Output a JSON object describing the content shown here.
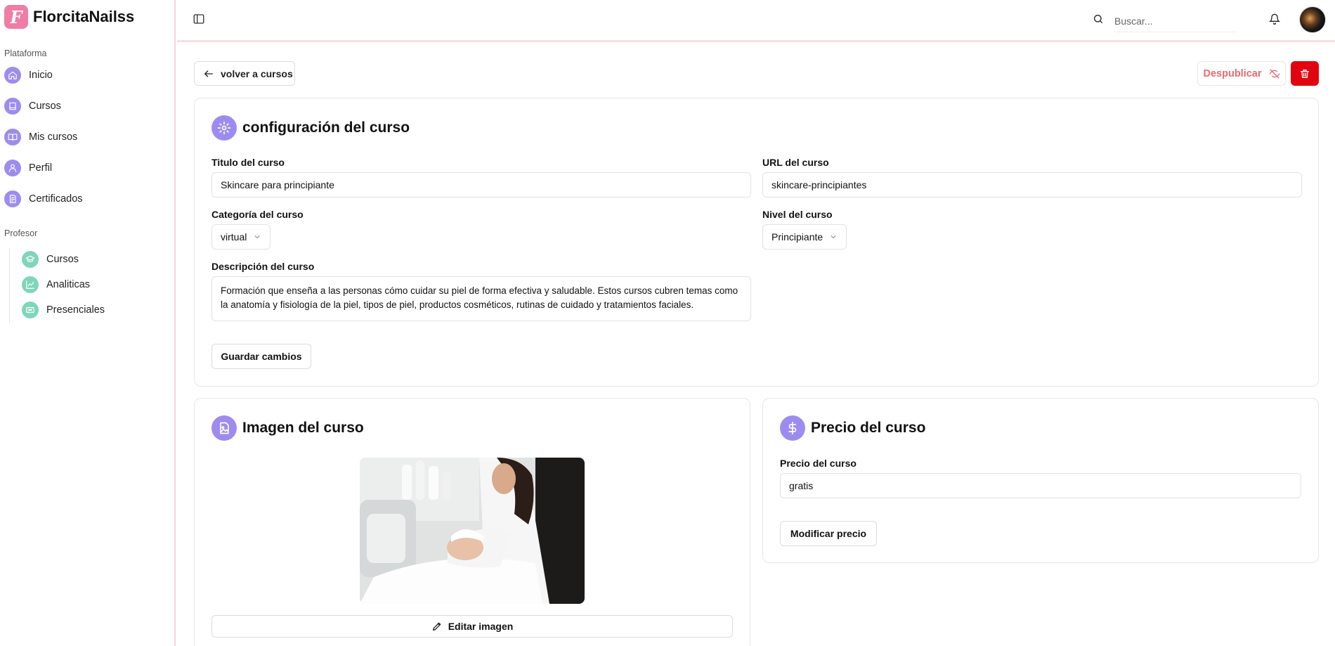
{
  "brand": {
    "name": "FlorcitaNailss",
    "logo_letter": "F"
  },
  "sidebar": {
    "platform_label": "Plataforma",
    "platform_items": [
      {
        "label": "Inicio",
        "icon": "home-icon"
      },
      {
        "label": "Cursos",
        "icon": "book-icon"
      },
      {
        "label": "Mis cursos",
        "icon": "book-open-icon"
      },
      {
        "label": "Perfil",
        "icon": "user-icon"
      },
      {
        "label": "Certificados",
        "icon": "certificate-icon"
      }
    ],
    "teacher_label": "Profesor",
    "teacher_items": [
      {
        "label": "Cursos",
        "icon": "graduation-cap-icon"
      },
      {
        "label": "Analiticas",
        "icon": "chart-icon"
      },
      {
        "label": "Presenciales",
        "icon": "ticket-icon"
      }
    ]
  },
  "header": {
    "search_placeholder": "Buscar..."
  },
  "actions": {
    "back_label": "volver a cursos",
    "unpublish_label": "Despublicar"
  },
  "config": {
    "title": "configuración del curso",
    "course_title_label": "Titulo del curso",
    "course_title_value": "Skincare para principiante",
    "url_label": "URL del curso",
    "url_value": "skincare-principiantes",
    "category_label": "Categoría del curso",
    "category_value": "virtual",
    "level_label": "Nivel del curso",
    "level_value": "Principiante",
    "description_label": "Descripción del curso",
    "description_value": "Formación que enseña a las personas cómo cuidar su piel de forma efectiva y saludable. Estos cursos cubren temas como la anatomía y fisiología de la piel, tipos de piel, productos cosméticos, rutinas de cuidado y tratamientos faciales.",
    "save_label": "Guardar cambios"
  },
  "image_card": {
    "title": "Imagen del curso",
    "edit_label": "Editar imagen"
  },
  "price_card": {
    "title": "Precio del curso",
    "price_label": "Precio del curso",
    "price_value": "gratis",
    "modify_label": "Modificar precio"
  },
  "colors": {
    "accent_purple": "#9d8cef",
    "accent_teal": "#7fd6b9",
    "brand_pink": "#f07da3",
    "danger_red": "#e2050f",
    "unpublish_text": "#e46b74"
  }
}
